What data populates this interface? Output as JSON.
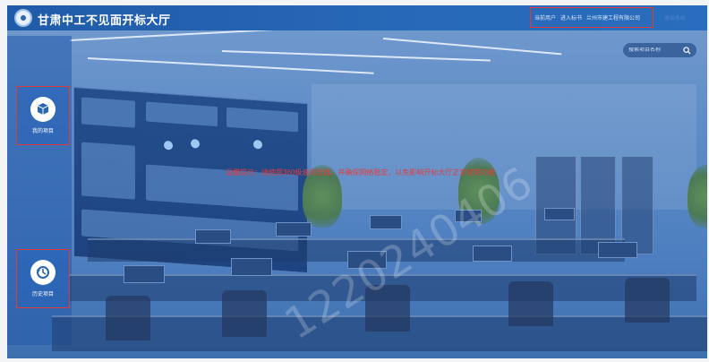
{
  "header": {
    "title": "甘肃中工不见面开标大厅",
    "user_info": [
      "当前用户",
      "进入标书",
      "兰州市建工程有限公司"
    ],
    "right_link": "退出系统"
  },
  "search": {
    "placeholder": "搜索项目名称"
  },
  "sidebar": {
    "items": [
      {
        "label": "我的项目",
        "icon": "box-icon"
      },
      {
        "label": "历史项目",
        "icon": "history-icon"
      }
    ]
  },
  "notice": "温馨提示：请使用360极速浏览器，并确保网络稳定，以免影响开标大厅正常使用功能",
  "watermark": "1220240406",
  "colors": {
    "accent": "#2a66b2",
    "highlight_border": "#e03b3b",
    "notice_text": "#e43b3b"
  }
}
